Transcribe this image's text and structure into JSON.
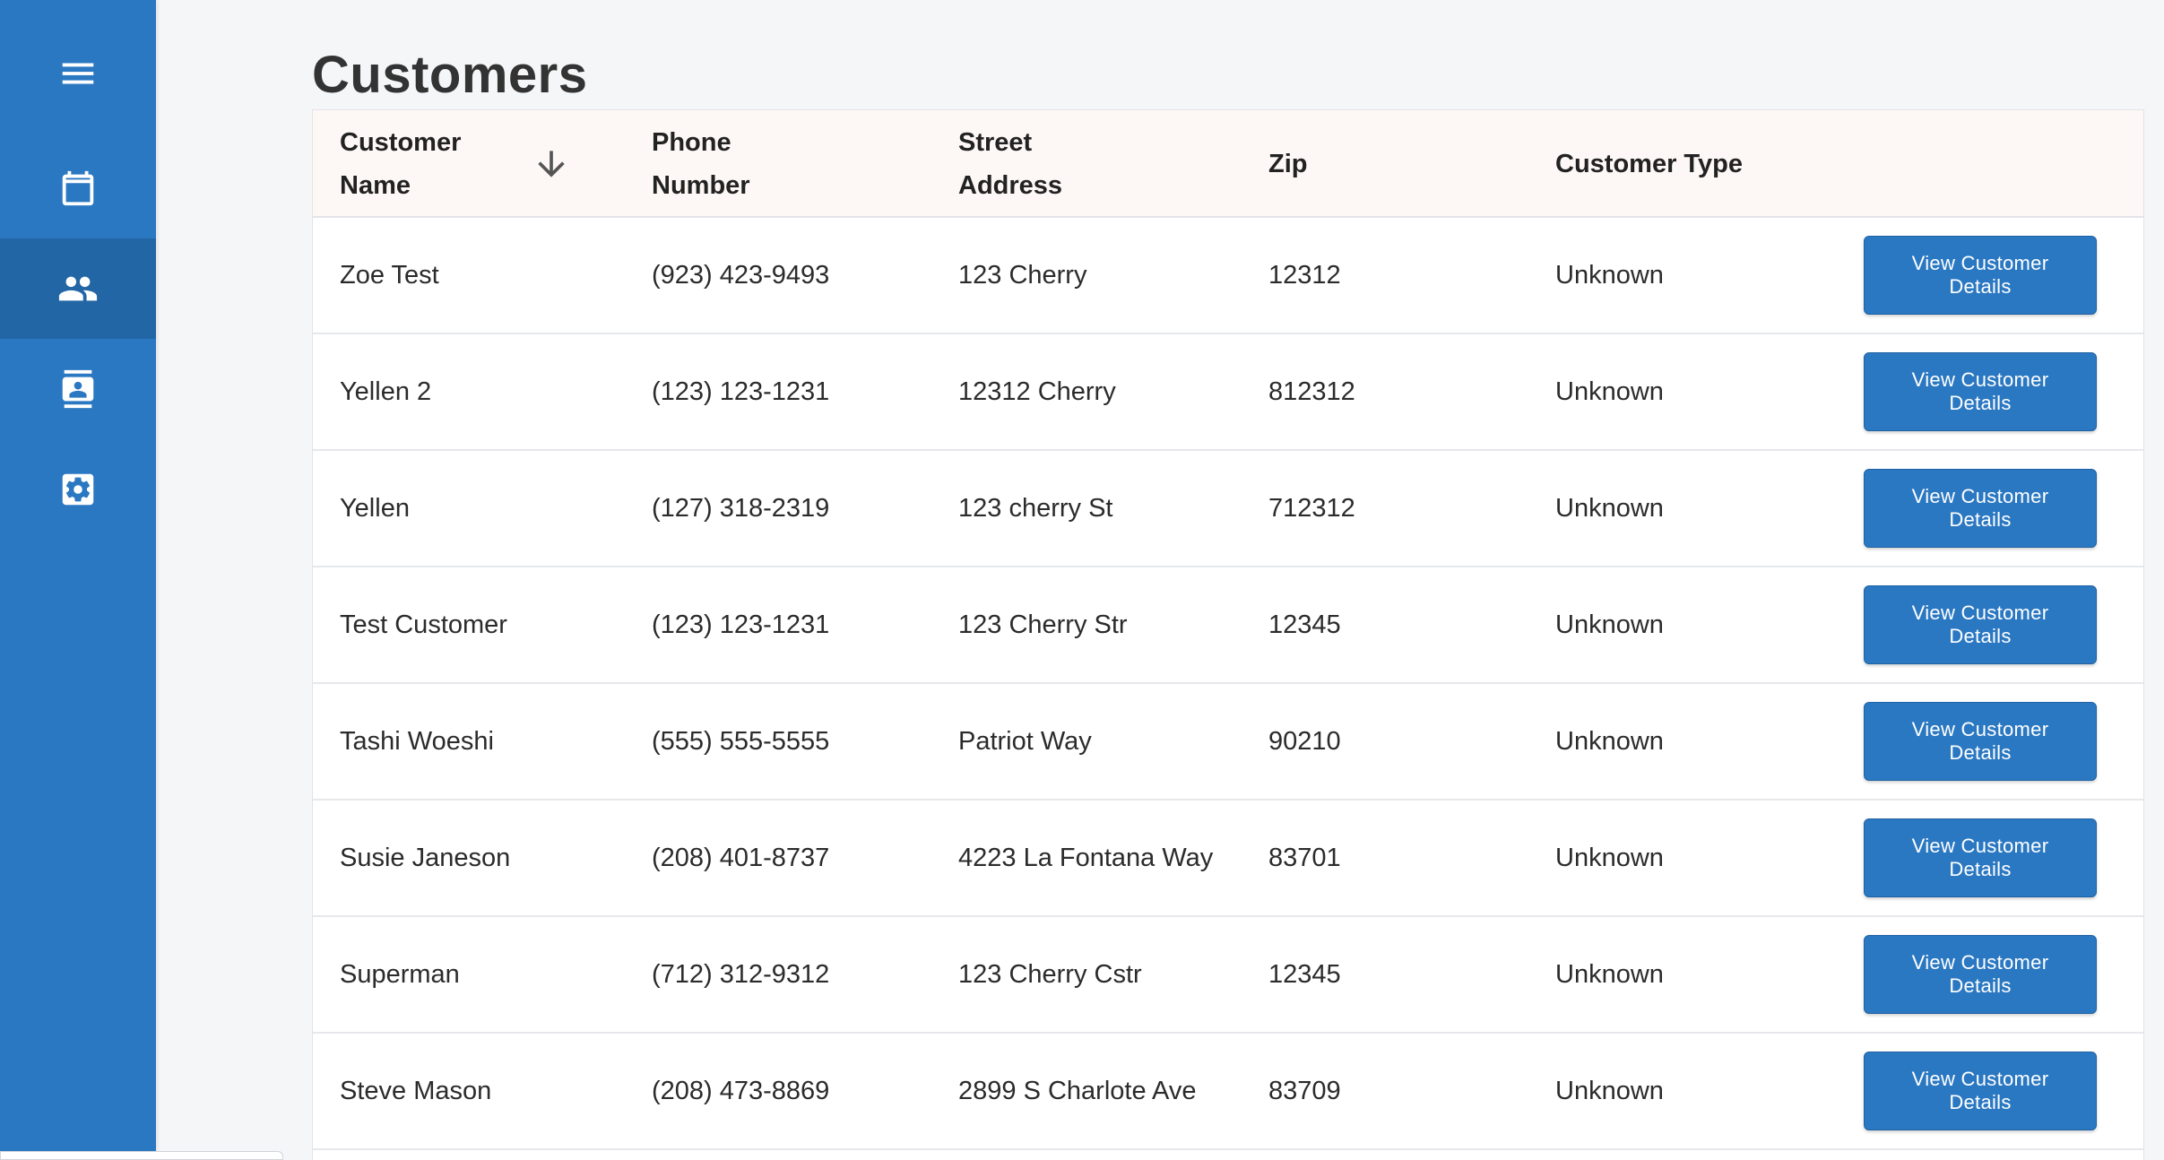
{
  "page": {
    "title": "Customers"
  },
  "sidebar": {
    "items": [
      {
        "icon": "menu-icon",
        "active": false
      },
      {
        "icon": "calendar-icon",
        "active": false
      },
      {
        "icon": "people-icon",
        "active": true
      },
      {
        "icon": "contact-card-icon",
        "active": false
      },
      {
        "icon": "settings-icon",
        "active": false
      }
    ]
  },
  "table": {
    "headers": {
      "name": "Customer Name",
      "phone": "Phone Number",
      "street": "Street Address",
      "zip": "Zip",
      "type": "Customer Type"
    },
    "sort": {
      "column": "name",
      "direction": "descending",
      "icon": "arrow-down-icon"
    },
    "rows": [
      {
        "name": "Zoe Test",
        "phone": "(923) 423-9493",
        "street": "123 Cherry",
        "zip": "12312",
        "type": "Unknown",
        "action": "View Customer Details"
      },
      {
        "name": "Yellen 2",
        "phone": "(123) 123-1231",
        "street": "12312 Cherry",
        "zip": "812312",
        "type": "Unknown",
        "action": "View Customer Details"
      },
      {
        "name": "Yellen",
        "phone": "(127) 318-2319",
        "street": "123 cherry St",
        "zip": "712312",
        "type": "Unknown",
        "action": "View Customer Details"
      },
      {
        "name": "Test Customer",
        "phone": "(123) 123-1231",
        "street": "123 Cherry Str",
        "zip": "12345",
        "type": "Unknown",
        "action": "View Customer Details"
      },
      {
        "name": "Tashi Woeshi",
        "phone": "(555) 555-5555",
        "street": "Patriot Way",
        "zip": "90210",
        "type": "Unknown",
        "action": "View Customer Details"
      },
      {
        "name": "Susie Janeson",
        "phone": "(208) 401-8737",
        "street": "4223 La Fontana Way",
        "zip": "83701",
        "type": "Unknown",
        "action": "View Customer Details"
      },
      {
        "name": "Superman",
        "phone": "(712) 312-9312",
        "street": "123 Cherry Cstr",
        "zip": "12345",
        "type": "Unknown",
        "action": "View Customer Details"
      },
      {
        "name": "Steve Mason",
        "phone": "(208) 473-8869",
        "street": "2899 S Charlote Ave",
        "zip": "83709",
        "type": "Unknown",
        "action": "View Customer Details"
      }
    ]
  },
  "colors": {
    "sidebar": "#2b78c2",
    "sidebar_active": "#2366a6",
    "button": "#2b78c2",
    "header_bg": "#fdf7f5",
    "page_bg": "#f5f6f8"
  }
}
